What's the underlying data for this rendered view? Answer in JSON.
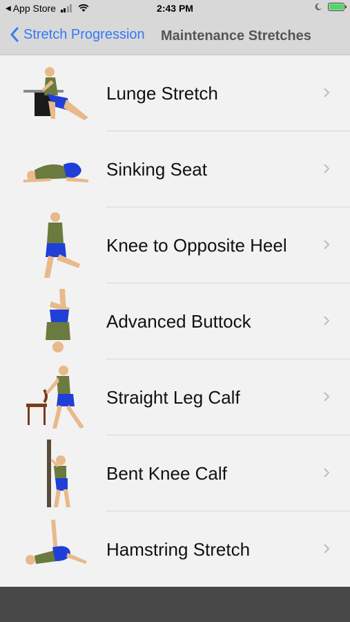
{
  "status_bar": {
    "carrier": "App Store",
    "time": "2:43 PM",
    "battery_color": "#4cd964"
  },
  "nav": {
    "back_label": "Stretch Progression",
    "title": "Maintenance Stretches"
  },
  "stretches": [
    {
      "label": "Lunge Stretch",
      "icon": "lunge-stretch-illustration"
    },
    {
      "label": "Sinking Seat",
      "icon": "sinking-seat-illustration"
    },
    {
      "label": "Knee to Opposite Heel",
      "icon": "knee-to-opposite-heel-illustration"
    },
    {
      "label": "Advanced Buttock",
      "icon": "advanced-buttock-illustration"
    },
    {
      "label": "Straight Leg Calf",
      "icon": "straight-leg-calf-illustration"
    },
    {
      "label": "Bent Knee Calf",
      "icon": "bent-knee-calf-illustration"
    },
    {
      "label": "Hamstring Stretch",
      "icon": "hamstring-stretch-illustration"
    }
  ],
  "colors": {
    "accent": "#3478f6",
    "shirt": "#6b7a3e",
    "shorts": "#1f3fd6",
    "skin": "#e8b98a"
  }
}
